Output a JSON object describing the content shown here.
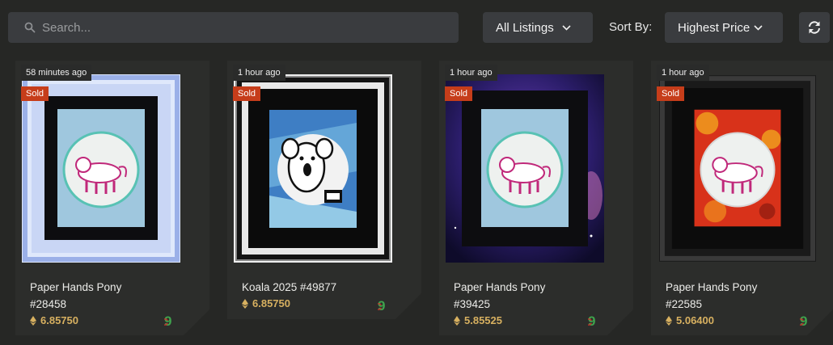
{
  "search": {
    "placeholder": "Search..."
  },
  "filters": {
    "listings_label": "All Listings",
    "sort_by_label": "Sort By:",
    "sort_value": "Highest Price"
  },
  "cards": [
    {
      "time": "58 minutes ago",
      "status": "Sold",
      "name": "Paper Hands Pony",
      "number": "#28458",
      "price": "6.85750"
    },
    {
      "time": "1 hour ago",
      "status": "Sold",
      "name": "Koala 2025 #49877",
      "number": "",
      "price": "6.85750"
    },
    {
      "time": "1 hour ago",
      "status": "Sold",
      "name": "Paper Hands Pony",
      "number": "#39425",
      "price": "5.85525"
    },
    {
      "time": "1 hour ago",
      "status": "Sold",
      "name": "Paper Hands Pony",
      "number": "#22585",
      "price": "5.06400"
    }
  ],
  "icons": {
    "search": "search-icon",
    "chevron": "chevron-down-icon",
    "refresh": "refresh-icon",
    "currency": "ethereum-icon",
    "marketplace": "marketplace-logo-icon"
  },
  "colors": {
    "background": "#262725",
    "control": "#3a3c3f",
    "sold_badge": "#c63d1a",
    "price": "#d7b060"
  }
}
